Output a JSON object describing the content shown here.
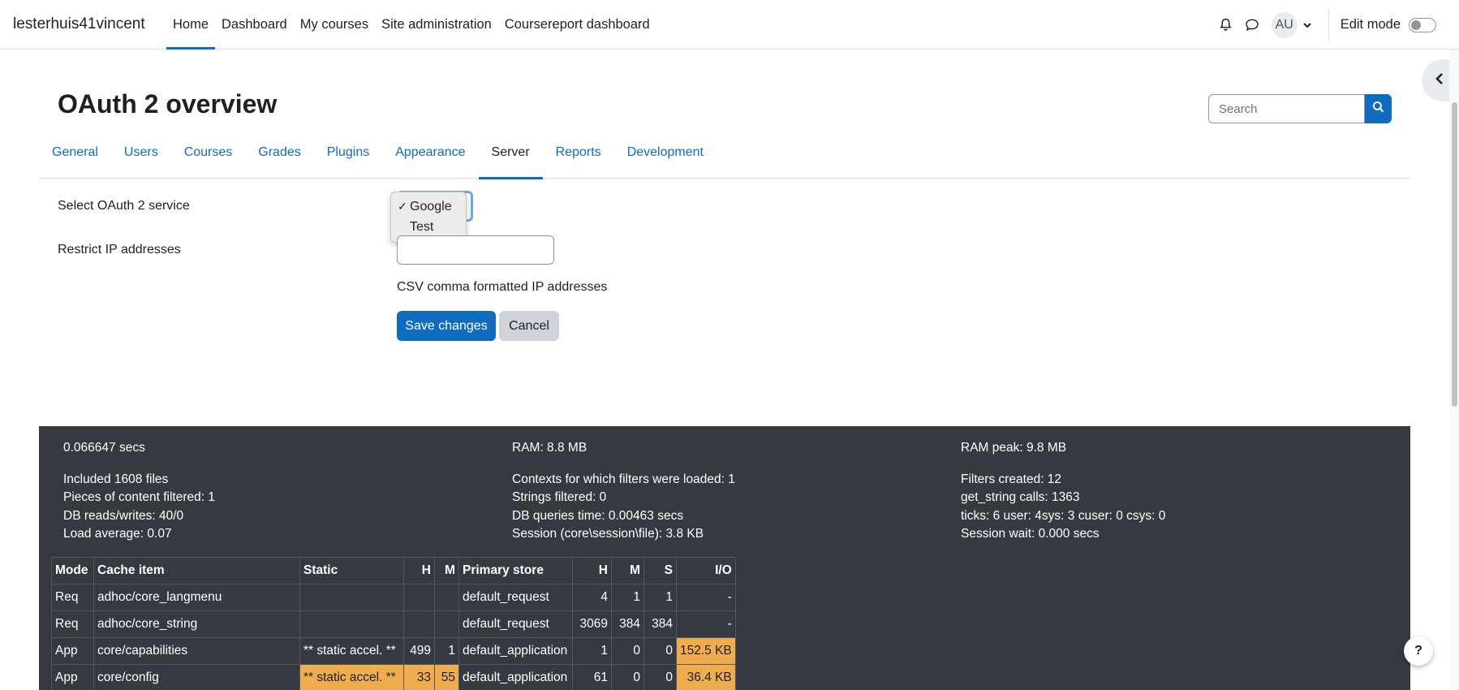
{
  "navbar": {
    "site_name": "lesterhuis41vincent",
    "items": [
      {
        "label": "Home"
      },
      {
        "label": "Dashboard"
      },
      {
        "label": "My courses"
      },
      {
        "label": "Site administration"
      },
      {
        "label": "Coursereport dashboard"
      }
    ],
    "avatar_initials": "AU",
    "edit_mode_label": "Edit mode"
  },
  "page": {
    "title": "OAuth 2 overview",
    "search_placeholder": "Search"
  },
  "tabs": [
    {
      "label": "General"
    },
    {
      "label": "Users"
    },
    {
      "label": "Courses"
    },
    {
      "label": "Grades"
    },
    {
      "label": "Plugins"
    },
    {
      "label": "Appearance"
    },
    {
      "label": "Server"
    },
    {
      "label": "Reports"
    },
    {
      "label": "Development"
    }
  ],
  "form": {
    "service_label": "Select OAuth 2 service",
    "service_options": [
      {
        "label": "Google",
        "selected": true
      },
      {
        "label": "Test",
        "selected": false
      }
    ],
    "ip_label": "Restrict IP addresses",
    "ip_value": "",
    "ip_help": "CSV comma formatted IP addresses",
    "save_label": "Save changes",
    "cancel_label": "Cancel"
  },
  "perf": {
    "col1": [
      "0.066647 secs",
      "Included 1608 files",
      "Pieces of content filtered: 1",
      "DB reads/writes: 40/0",
      "Load average: 0.07"
    ],
    "col2": [
      "RAM: 8.8 MB",
      "Contexts for which filters were loaded: 1",
      "Strings filtered: 0",
      "DB queries time: 0.00463 secs",
      "Session (core\\session\\file): 3.8 KB"
    ],
    "col3": [
      "RAM peak: 9.8 MB",
      "Filters created: 12",
      "get_string calls: 1363",
      "ticks: 6 user: 4sys: 3 cuser: 0 csys: 0",
      "Session wait: 0.000 secs"
    ]
  },
  "cache_table": {
    "headers": [
      "Mode",
      "Cache item",
      "Static",
      "H",
      "M",
      "Primary store",
      "H",
      "M",
      "S",
      "I/O"
    ],
    "rows": [
      [
        "Req",
        "adhoc/core_langmenu",
        "",
        "",
        "",
        "default_request",
        "4",
        "1",
        "1",
        "-"
      ],
      [
        "Req",
        "adhoc/core_string",
        "",
        "",
        "",
        "default_request",
        "3069",
        "384",
        "384",
        "-"
      ],
      [
        "App",
        "core/capabilities",
        "** static accel. **",
        "499",
        "1",
        "default_application",
        "1",
        "0",
        "0",
        "152.5 KB"
      ],
      [
        "App",
        "core/config",
        "** static accel. **",
        "33",
        "55",
        "default_application",
        "61",
        "0",
        "0",
        "36.4 KB"
      ]
    ]
  },
  "colors": {
    "primary": "#0f6cbf",
    "footer_bg": "#343a40",
    "highlight": "#f0ad4e"
  },
  "icons": {
    "notification": "bell-icon",
    "messages": "chat-icon",
    "drawer": "chevron-left-icon",
    "search": "search-icon",
    "help": "question-icon"
  }
}
